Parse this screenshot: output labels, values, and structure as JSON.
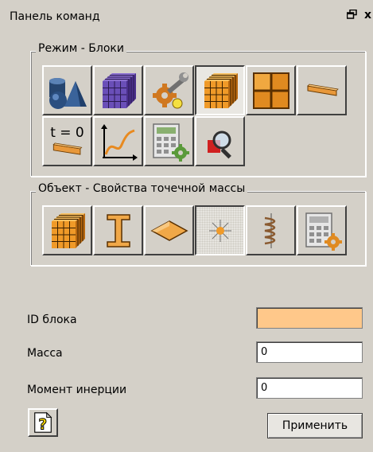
{
  "window": {
    "title": "Панель команд",
    "icons": [
      "restore-icon",
      "close-icon"
    ],
    "close_glyph": "x"
  },
  "mode_group": {
    "legend": "Режим - Блоки",
    "buttons": [
      {
        "name": "primitives-icon",
        "pressed": false
      },
      {
        "name": "purple-block-icon",
        "pressed": false
      },
      {
        "name": "wrench-gear-icon",
        "pressed": false
      },
      {
        "name": "orange-block-icon",
        "pressed": true
      },
      {
        "name": "grid-icon",
        "pressed": false
      },
      {
        "name": "beam-icon",
        "pressed": false
      },
      {
        "name": "initial-time-icon",
        "label": "t = 0",
        "pressed": false
      },
      {
        "name": "graph-icon",
        "pressed": false
      },
      {
        "name": "calculator-icon",
        "pressed": false
      },
      {
        "name": "magnifier-icon",
        "pressed": false
      }
    ]
  },
  "object_group": {
    "legend": "Объект - Свойства точечной массы",
    "buttons": [
      {
        "name": "block-object-icon",
        "pressed": false
      },
      {
        "name": "i-beam-icon",
        "pressed": false
      },
      {
        "name": "plate-icon",
        "pressed": false
      },
      {
        "name": "point-mass-icon",
        "pressed": true
      },
      {
        "name": "spring-icon",
        "pressed": false
      },
      {
        "name": "calculator-settings-icon",
        "pressed": false
      }
    ]
  },
  "fields": {
    "block_id_label": "ID блока",
    "block_id_value": "",
    "mass_label": "Масса",
    "mass_value": "0",
    "inertia_label": "Момент инерции",
    "inertia_value": "0"
  },
  "buttons": {
    "help_icon": "help-icon",
    "apply_label": "Применить"
  },
  "colors": {
    "background": "#d4d0c8",
    "block_id_field": "#ffc88a",
    "accent_orange": "#f0a030"
  }
}
